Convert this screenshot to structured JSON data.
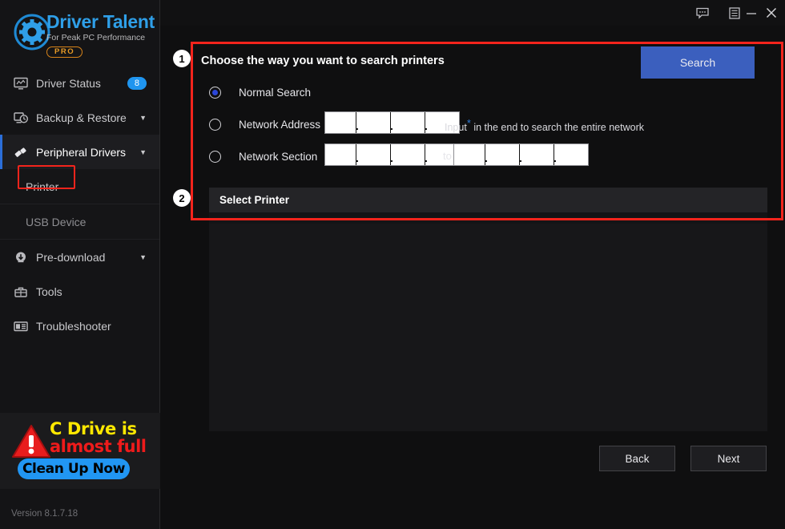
{
  "app": {
    "brand_primary": "Driver",
    "brand_secondary": " Talent",
    "brand_tagline": "For Peak PC Performance",
    "brand_edition": "PRO",
    "version": "Version 8.1.7.18",
    "accent_blue": "#2f9fe8",
    "accent_button": "#3b5fbe",
    "highlight_red": "#f4241c"
  },
  "titlebar": {
    "feedback_icon": "chat-bubble-icon",
    "menu_icon": "list-menu-icon",
    "minimize_icon": "minimize-icon",
    "close_icon": "close-icon"
  },
  "sidebar": {
    "items": [
      {
        "label": "Driver Status",
        "icon": "monitor-icon",
        "badge": "8",
        "caret": "",
        "active": false
      },
      {
        "label": "Backup & Restore",
        "icon": "backup-clock-icon",
        "badge": "",
        "caret": "▼",
        "active": false
      },
      {
        "label": "Peripheral Drivers",
        "icon": "usb-plug-icon",
        "badge": "",
        "caret": "▼",
        "active": true
      },
      {
        "label": "Pre-download",
        "icon": "cloud-download-icon",
        "badge": "",
        "caret": "▼",
        "active": false
      },
      {
        "label": "Tools",
        "icon": "toolbox-icon",
        "badge": "",
        "caret": "",
        "active": false
      },
      {
        "label": "Troubleshooter",
        "icon": "troubleshoot-icon",
        "badge": "",
        "caret": "",
        "active": false
      }
    ],
    "sub_items": [
      {
        "label": "Printer",
        "highlighted": true
      },
      {
        "label": "USB Device",
        "highlighted": false
      }
    ]
  },
  "ad": {
    "line1": "C Drive is",
    "line2": "almost full",
    "button": "Clean Up Now",
    "warning_icon": "warning-triangle-icon",
    "line1_color": "#ffe800",
    "line2_color": "#ef1b1b",
    "button_color": "#2196f3"
  },
  "main": {
    "step1_badge": "1",
    "step2_badge": "2",
    "section_title": "Choose the way you want to search printers",
    "search_button": "Search",
    "options": [
      {
        "label": "Normal Search",
        "selected": true
      },
      {
        "label": "Network Address",
        "selected": false
      },
      {
        "label": "Network Section",
        "selected": false
      }
    ],
    "hint_before": "Input",
    "hint_star": "*",
    "hint_after": "in the end to search the entire network",
    "to_label": "to",
    "network_address_octets": [
      "",
      "",
      "",
      ""
    ],
    "network_section_from": [
      "",
      "",
      "",
      ""
    ],
    "network_section_to": [
      "",
      "",
      "",
      ""
    ],
    "select_printer_label": "Select Printer",
    "printer_list_items": [],
    "back_button": "Back",
    "next_button": "Next"
  }
}
